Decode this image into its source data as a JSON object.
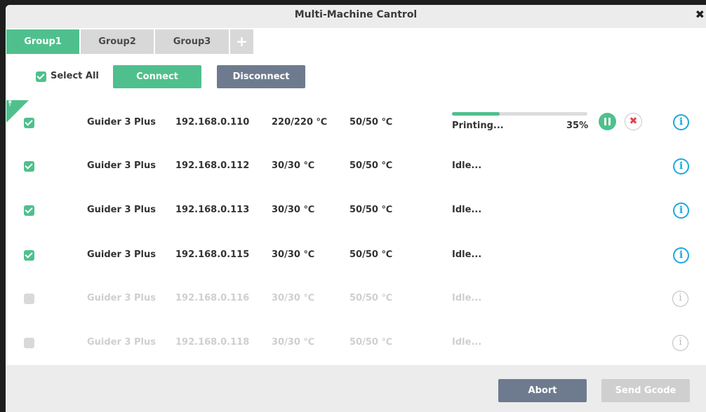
{
  "window": {
    "title": "Multi-Machine Cantrol",
    "close_glyph": "✖"
  },
  "tabs": [
    {
      "label": "Group1",
      "active": true
    },
    {
      "label": "Group2",
      "active": false
    },
    {
      "label": "Group3",
      "active": false
    }
  ],
  "add_tab_glyph": "+",
  "toolbar": {
    "select_all_label": "Select All",
    "select_all_checked": true,
    "connect_label": "Connect",
    "disconnect_label": "Disconnect"
  },
  "machines": [
    {
      "checked": true,
      "enabled": true,
      "name": "Guider 3 Plus",
      "ip": "192.168.0.110",
      "nozzle_temp": "220/220 ℃",
      "bed_temp": "50/50 ℃",
      "status": "Printing...",
      "progress_percent": 35,
      "progress_label": "35%"
    },
    {
      "checked": true,
      "enabled": true,
      "name": "Guider 3 Plus",
      "ip": "192.168.0.112",
      "nozzle_temp": "30/30 ℃",
      "bed_temp": "50/50 ℃",
      "status": "Idle..."
    },
    {
      "checked": true,
      "enabled": true,
      "name": "Guider 3 Plus",
      "ip": "192.168.0.113",
      "nozzle_temp": "30/30 ℃",
      "bed_temp": "50/50 ℃",
      "status": "Idle..."
    },
    {
      "checked": true,
      "enabled": true,
      "name": "Guider 3 Plus",
      "ip": "192.168.0.115",
      "nozzle_temp": "30/30 ℃",
      "bed_temp": "50/50 ℃",
      "status": "Idle..."
    },
    {
      "checked": false,
      "enabled": false,
      "name": "Guider 3 Plus",
      "ip": "192.168.0.116",
      "nozzle_temp": "30/30 ℃",
      "bed_temp": "50/50 ℃",
      "status": "Idle..."
    },
    {
      "checked": false,
      "enabled": false,
      "name": "Guider 3 Plus",
      "ip": "192.168.0.118",
      "nozzle_temp": "30/30 ℃",
      "bed_temp": "50/50 ℃",
      "status": "Idle..."
    }
  ],
  "icons": {
    "info": "i",
    "stop": "✖"
  },
  "footer": {
    "abort_label": "Abort",
    "send_gcode_label": "Send Gcode"
  },
  "colors": {
    "accent": "#4fc08d",
    "slate": "#6e7b8f",
    "info": "#1aa9e0",
    "stop": "#e04050"
  }
}
